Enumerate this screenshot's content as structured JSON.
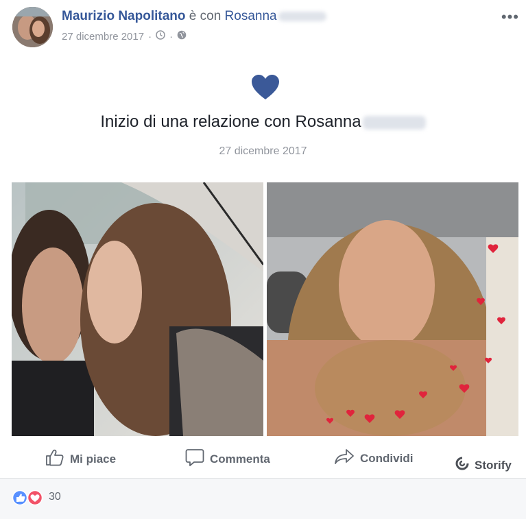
{
  "post": {
    "author": "Maurizio Napolitano",
    "with_text": "è con",
    "tagged_name": "Rosanna",
    "date": "27 dicembre 2017",
    "separator": "·",
    "more_label": "•••"
  },
  "event": {
    "icon": "heart-icon",
    "title": "Inizio di una relazione con Rosanna",
    "date": "27 dicembre 2017"
  },
  "actions": {
    "like": "Mi piace",
    "comment": "Commenta",
    "share": "Condividi",
    "storify": "Storify"
  },
  "reactions": {
    "count": "30",
    "types": [
      "like-icon",
      "love-icon"
    ]
  },
  "colors": {
    "link": "#365899",
    "heart": "#3b5998",
    "muted": "#90949c",
    "like_blue": "#5890ff",
    "love_red": "#f25268"
  }
}
